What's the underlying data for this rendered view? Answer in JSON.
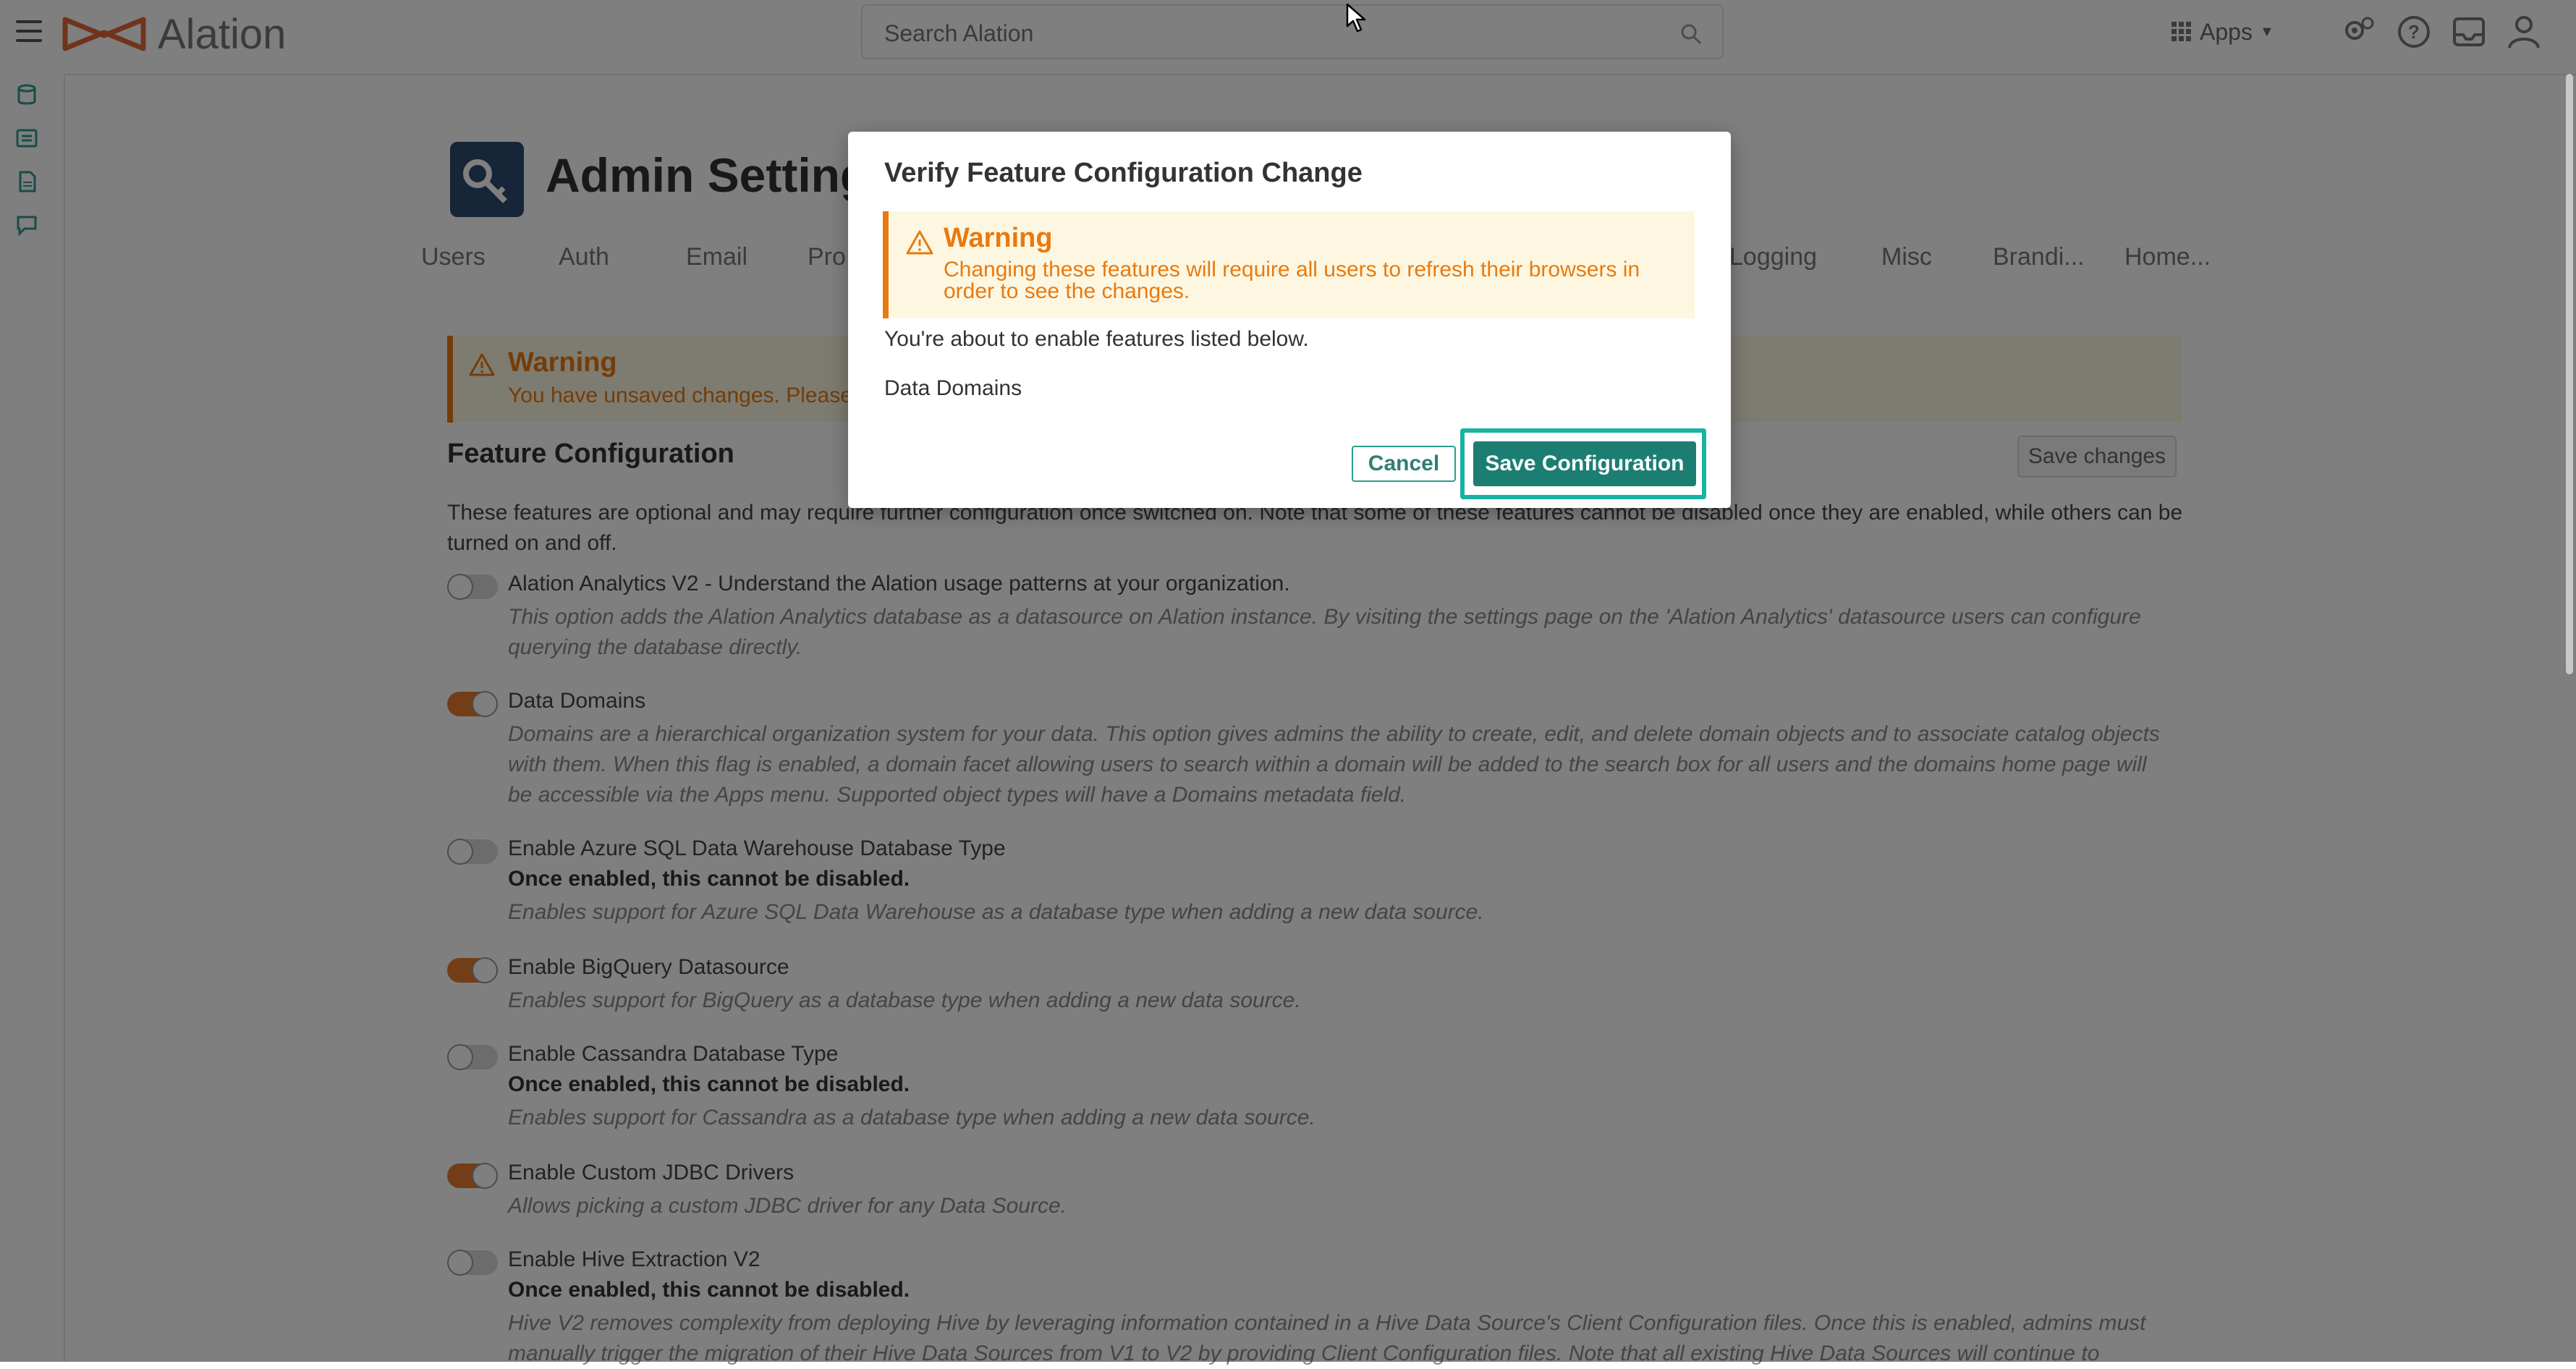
{
  "app": {
    "logo_text": "Alation"
  },
  "header": {
    "search_placeholder": "Search Alation",
    "apps_label": "Apps",
    "icons": [
      "settings-icon",
      "help-icon",
      "inbox-icon",
      "user-icon"
    ]
  },
  "left_rail": {
    "icons": [
      "database-icon",
      "catalog-icon",
      "document-icon",
      "conversation-icon"
    ]
  },
  "page": {
    "title": "Admin Settings",
    "title_visible": "Admin Setting",
    "tabs": [
      "Users",
      "Auth",
      "Email",
      "Pro",
      "Logging",
      "Misc",
      "Brandi...",
      "Home..."
    ],
    "warning": {
      "title": "Warning",
      "text": "You have unsaved changes. Please c"
    },
    "section_title": "Feature Configuration",
    "save_changes_label": "Save changes",
    "intro": "These features are optional and may require further configuration once switched on. Note that some of these features cannot be disabled once they are enabled, while others can be turned on and off.",
    "features": [
      {
        "title": "Alation Analytics V2 - Understand the Alation usage patterns at your organization.",
        "enabled": false,
        "warning": "",
        "description": "This option adds the Alation Analytics database as a datasource on Alation instance. By visiting the settings page on the 'Alation Analytics' datasource users can configure querying the database directly."
      },
      {
        "title": "Data Domains",
        "enabled": true,
        "warning": "",
        "description": "Domains are a hierarchical organization system for your data. This option gives admins the ability to create, edit, and delete domain objects and to associate catalog objects with them. When this flag is enabled, a domain facet allowing users to search within a domain will be added to the search box for all users and the domains home page will be accessible via the Apps menu. Supported object types will have a Domains metadata field."
      },
      {
        "title": "Enable Azure SQL Data Warehouse Database Type",
        "enabled": false,
        "warning": "Once enabled, this cannot be disabled.",
        "description": "Enables support for Azure SQL Data Warehouse as a database type when adding a new data source."
      },
      {
        "title": "Enable BigQuery Datasource",
        "enabled": true,
        "warning": "",
        "description": "Enables support for BigQuery as a database type when adding a new data source."
      },
      {
        "title": "Enable Cassandra Database Type",
        "enabled": false,
        "warning": "Once enabled, this cannot be disabled.",
        "description": "Enables support for Cassandra as a database type when adding a new data source."
      },
      {
        "title": "Enable Custom JDBC Drivers",
        "enabled": true,
        "warning": "",
        "description": "Allows picking a custom JDBC driver for any Data Source."
      },
      {
        "title": "Enable Hive Extraction V2",
        "enabled": false,
        "warning": "Once enabled, this cannot be disabled.",
        "description": "Hive V2 removes complexity from deploying Hive by leveraging information contained in a Hive Data Source's Client Configuration files. Once this is enabled, admins must manually trigger the migration of their Hive Data Sources from V1 to V2 by providing Client Configuration files. Note that all existing Hive Data Sources will continue to"
      }
    ]
  },
  "modal": {
    "title": "Verify Feature Configuration Change",
    "warning_title": "Warning",
    "warning_text": "Changing these features will require all users to refresh their browsers in order to see the changes.",
    "message": "You're about to enable features listed below.",
    "features": [
      "Data Domains"
    ],
    "cancel_label": "Cancel",
    "save_label": "Save Configuration"
  },
  "colors": {
    "accent": "#1c7e72",
    "focus": "#18b3a2",
    "warning": "#e87a10",
    "warning_bg": "#fdf7e2",
    "toggle_on": "#e47a2e",
    "logo": "#e0693a"
  }
}
